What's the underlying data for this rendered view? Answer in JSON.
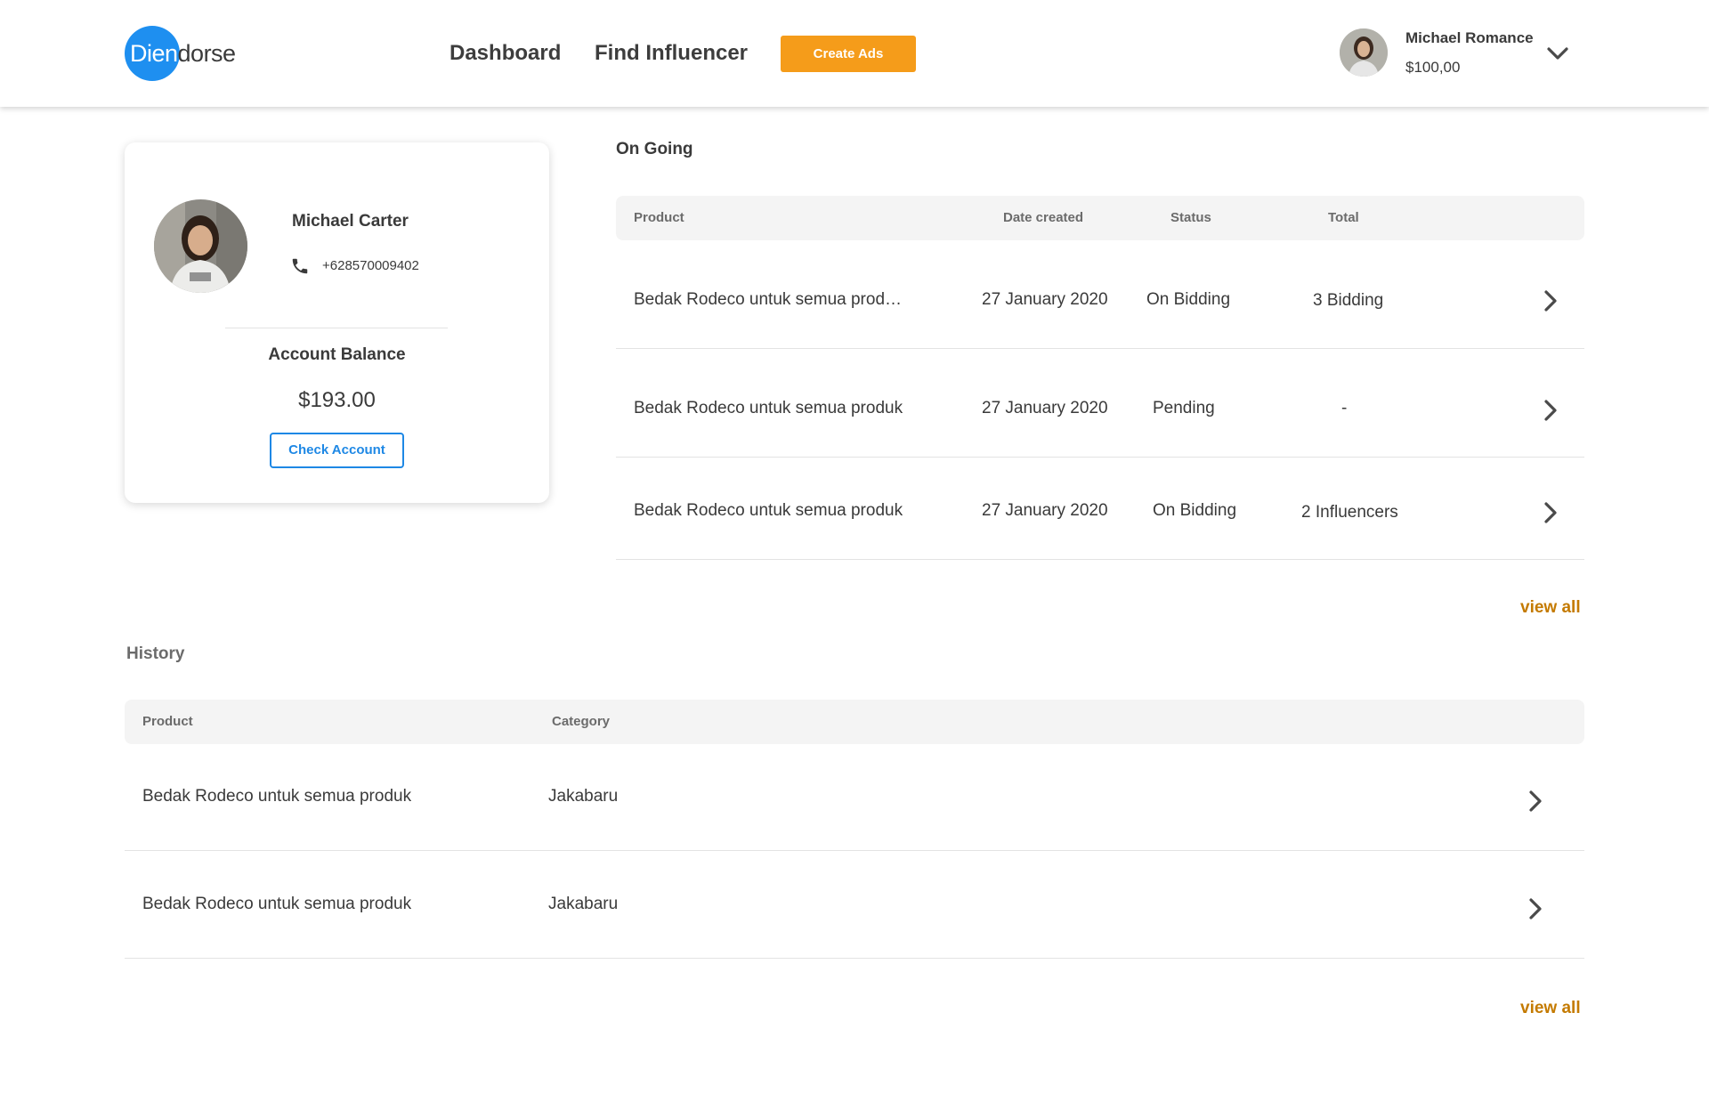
{
  "brand": {
    "logo_part1": "Dien",
    "logo_part2": "dorse",
    "accent": "#1e8ff0"
  },
  "nav": {
    "dashboard": "Dashboard",
    "find_influencer": "Find Influencer",
    "create_ads": "Create Ads",
    "create_ads_color": "#f59c1a"
  },
  "user": {
    "name": "Michael Romance",
    "balance": "$100,00",
    "menu_icon": "chevron-down-icon"
  },
  "profile": {
    "name": "Michael Carter",
    "phone": "+628570009402",
    "phone_icon": "phone-icon",
    "balance_label": "Account Balance",
    "balance": "$193.00",
    "check_account": "Check Account"
  },
  "ongoing": {
    "title": "On Going",
    "columns": {
      "product": "Product",
      "date": "Date created",
      "status": "Status",
      "total": "Total"
    },
    "rows": [
      {
        "product": "Bedak Rodeco untuk semua prod…",
        "date": "27 January 2020",
        "status": "On Bidding",
        "total": "3 Bidding"
      },
      {
        "product": "Bedak Rodeco untuk semua produk",
        "date": "27 January 2020",
        "status": "Pending",
        "total": "-"
      },
      {
        "product": "Bedak Rodeco untuk semua produk",
        "date": "27 January 2020",
        "status": "On Bidding",
        "total": "2 Influencers"
      }
    ],
    "view_all": "view all"
  },
  "history": {
    "title": "History",
    "columns": {
      "product": "Product",
      "category": "Category"
    },
    "rows": [
      {
        "product": "Bedak Rodeco untuk semua produk",
        "category": "Jakabaru"
      },
      {
        "product": "Bedak Rodeco untuk semua produk",
        "category": "Jakabaru"
      }
    ],
    "view_all": "view all"
  },
  "colors": {
    "link": "#c47a00",
    "outline_button": "#1e88e5"
  }
}
